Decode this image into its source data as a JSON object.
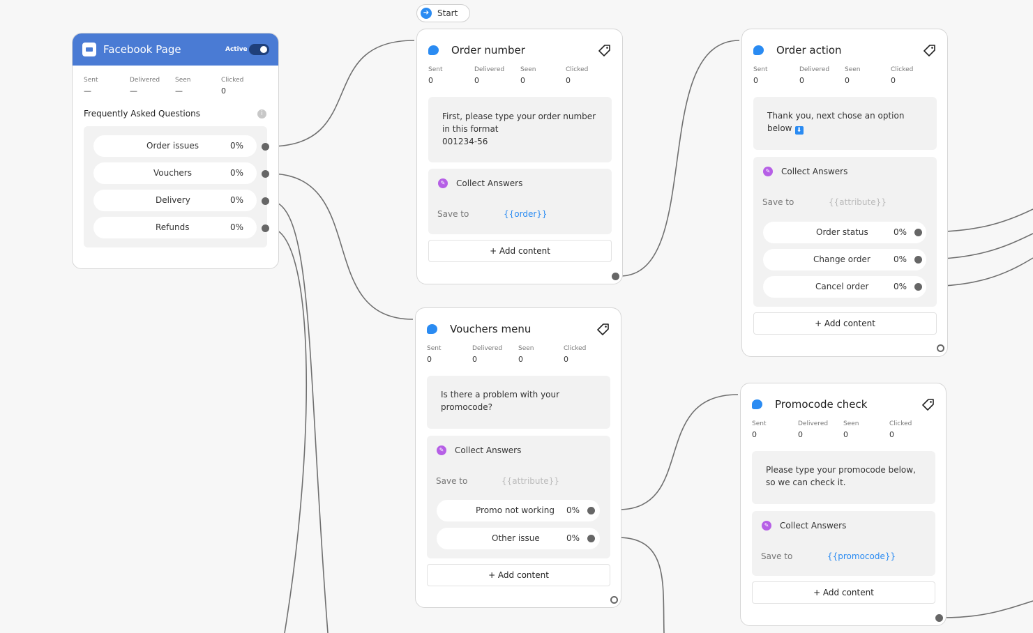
{
  "start": {
    "label": "Start",
    "icon": "arrow-right-circle-icon"
  },
  "stat_labels": {
    "sent": "Sent",
    "delivered": "Delivered",
    "seen": "Seen",
    "clicked": "Clicked"
  },
  "colors": {
    "accent": "#2a8bf2",
    "header": "#4a7bd4",
    "collect": "#b65fe6",
    "wire": "#6f6f6f"
  },
  "facebook": {
    "title": "Facebook Page",
    "status": "Active",
    "toggle_on": true,
    "stats": {
      "sent": "—",
      "delivered": "—",
      "seen": "—",
      "clicked": "0"
    },
    "faq_title": "Frequently Asked Questions",
    "info": "i",
    "options": [
      {
        "label": "Order issues",
        "pct": "0%"
      },
      {
        "label": "Vouchers",
        "pct": "0%"
      },
      {
        "label": "Delivery",
        "pct": "0%"
      },
      {
        "label": "Refunds",
        "pct": "0%"
      }
    ]
  },
  "order_number": {
    "title": "Order number",
    "stats": {
      "sent": "0",
      "delivered": "0",
      "seen": "0",
      "clicked": "0"
    },
    "message_lines": [
      "First, please type your order number",
      "in this format",
      "001234-56"
    ],
    "collect_label": "Collect Answers",
    "save_label": "Save to",
    "save_value": "{{order}}",
    "add_label": "+ Add content"
  },
  "vouchers_menu": {
    "title": "Vouchers menu",
    "stats": {
      "sent": "0",
      "delivered": "0",
      "seen": "0",
      "clicked": "0"
    },
    "message_lines": [
      "Is there a problem with your",
      "promocode?"
    ],
    "collect_label": "Collect Answers",
    "save_label": "Save to",
    "save_value": "{{attribute}}",
    "options": [
      {
        "label": "Promo not working",
        "pct": "0%"
      },
      {
        "label": "Other issue",
        "pct": "0%"
      }
    ],
    "add_label": "+ Add content"
  },
  "order_action": {
    "title": "Order action",
    "stats": {
      "sent": "0",
      "delivered": "0",
      "seen": "0",
      "clicked": "0"
    },
    "message_lines": [
      "Thank you, next chose an option",
      "below"
    ],
    "badge": "⬇",
    "collect_label": "Collect Answers",
    "save_label": "Save to",
    "save_value": "{{attribute}}",
    "options": [
      {
        "label": "Order status",
        "pct": "0%"
      },
      {
        "label": "Change order",
        "pct": "0%"
      },
      {
        "label": "Cancel order",
        "pct": "0%"
      }
    ],
    "add_label": "+ Add content"
  },
  "promocode_check": {
    "title": "Promocode check",
    "stats": {
      "sent": "0",
      "delivered": "0",
      "seen": "0",
      "clicked": "0"
    },
    "message_lines": [
      "Please type your promocode below,",
      "so we can check it."
    ],
    "collect_label": "Collect Answers",
    "save_label": "Save to",
    "save_value": "{{promocode}}",
    "add_label": "+ Add content"
  }
}
